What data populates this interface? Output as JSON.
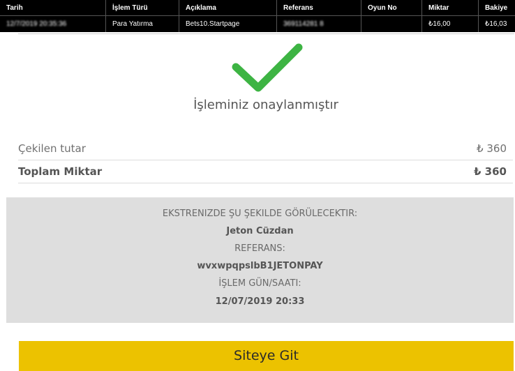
{
  "table": {
    "headers": [
      "Tarih",
      "İşlem Türü",
      "Açıklama",
      "Referans",
      "Oyun No",
      "Miktar",
      "Bakiye"
    ],
    "row": [
      "12/7/2019 20:35:36",
      "Para Yatırma",
      "Bets10.Startpage",
      "369114281 8",
      "",
      "₺16,00",
      "₺16,03"
    ]
  },
  "confirmation": {
    "message": "İşleminiz onaylanmıştır",
    "icon": "check-icon",
    "color": "#3db443"
  },
  "summary": {
    "withdrawn_label": "Çekilen tutar",
    "withdrawn_amount": "₺ 360",
    "total_label": "Toplam Miktar",
    "total_amount": "₺ 360"
  },
  "statement": {
    "heading": "EKSTRENIZDE ŞU ŞEKILDE GÖRÜLECEKTIR:",
    "merchant": "Jeton Cüzdan",
    "reference_label": "REFERANS:",
    "reference_value": "wvxwpqpslbB1JETONPAY",
    "datetime_label": "İŞLEM GÜN/SAATI:",
    "datetime_value": "12/07/2019 20:33"
  },
  "button": {
    "label": "Siteye Git",
    "color": "#ecc200"
  }
}
